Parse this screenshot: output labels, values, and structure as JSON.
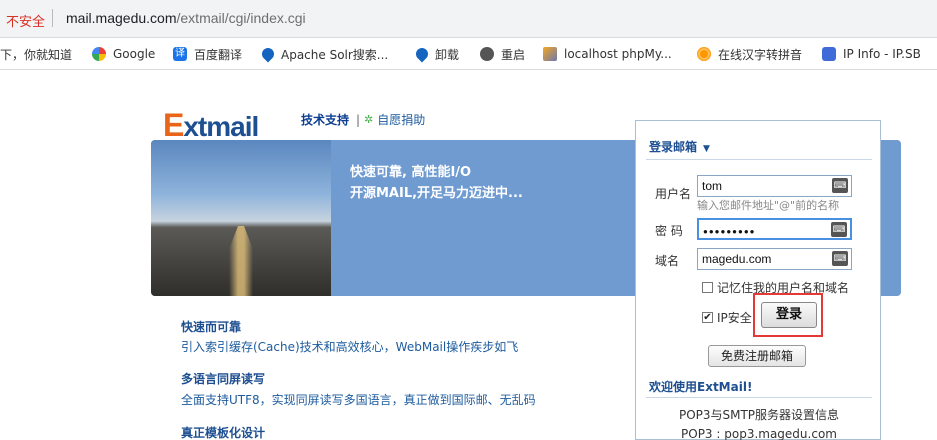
{
  "browser": {
    "insecure_label": "不安全",
    "url_host": "mail.magedu.com",
    "url_path": "/extmail/cgi/index.cgi"
  },
  "bookmarks": [
    {
      "label": "下，你就知道",
      "icon": "bookmark-icon"
    },
    {
      "label": "Google",
      "icon": "google-icon"
    },
    {
      "label": "百度翻译",
      "icon": "translate-icon"
    },
    {
      "label": "Apache Solr搜索...",
      "icon": "solr-icon"
    },
    {
      "label": "卸载",
      "icon": "uninstall-icon"
    },
    {
      "label": "重启",
      "icon": "globe-icon"
    },
    {
      "label": "localhost phpMy...",
      "icon": "phpmyadmin-icon"
    },
    {
      "label": "在线汉字转拼音",
      "icon": "pinyin-icon"
    },
    {
      "label": "IP Info - IP.SB",
      "icon": "ip-info-icon"
    }
  ],
  "header": {
    "logo_e": "E",
    "logo_rest": "xtmail",
    "tech_support": "技术支持",
    "donate": "自愿捐助",
    "sep": "|"
  },
  "banner": {
    "line1": "快速可靠, 高性能I/O",
    "line2": "开源MAIL,开足马力迈进中..."
  },
  "features": [
    {
      "title": "快速而可靠",
      "desc": "引入索引缓存(Cache)技术和高效核心，WebMail操作疾步如飞"
    },
    {
      "title": "多语言同屏读写",
      "desc": "全面支持UTF8，实现同屏读写多国语言，真正做到国际邮、无乱码"
    },
    {
      "title": "真正模板化设计",
      "desc": ""
    }
  ],
  "login": {
    "heading": "登录邮箱",
    "heading_arrow": "▼",
    "username_label": "用户名",
    "username_value": "tom",
    "username_hint": "输入您邮件地址\"@\"前的名称",
    "password_label": "密 码",
    "password_value": "●●●●●●●●●",
    "domain_label": "域名",
    "domain_value": "magedu.com",
    "remember_label": "记忆住我的用户名和域名",
    "remember_checked": false,
    "ip_secure_label": "IP安全",
    "ip_secure_checked": true,
    "submit_label": "登录",
    "register_label": "免费注册邮箱",
    "welcome": "欢迎使用ExtMail!",
    "pop_info_title": "POP3与SMTP服务器设置信息",
    "pop3": "POP3 : pop3.magedu.com"
  },
  "colors": {
    "insecure": "#d93025",
    "banner_bg": "#6f9bd1",
    "link": "#1d4f91",
    "highlight_box": "#e53935"
  }
}
